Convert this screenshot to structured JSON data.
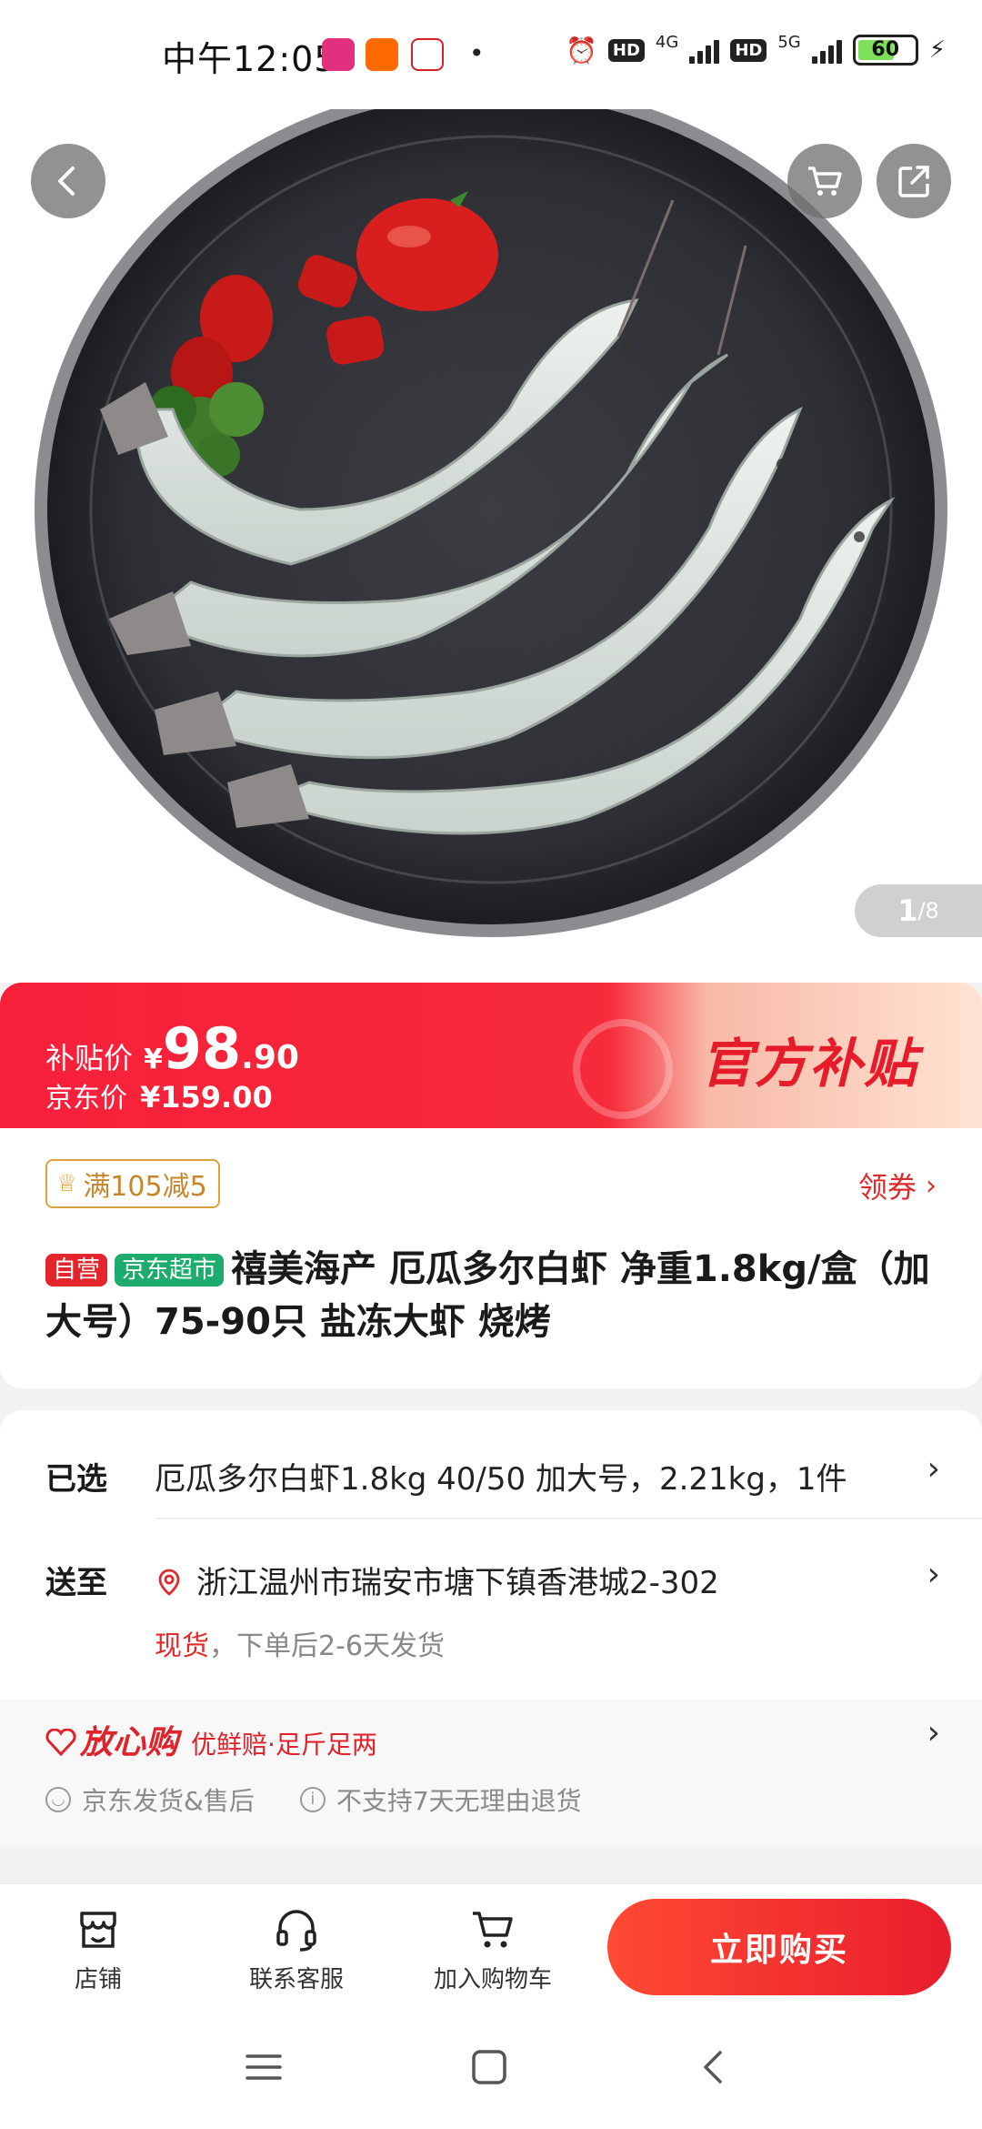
{
  "status_bar": {
    "time": "中午12:05",
    "app_icons": [
      "vipshop-icon",
      "taobao-icon",
      "kfc-icon"
    ],
    "network_1": "4G",
    "network_2": "5G",
    "battery": "60",
    "battery_level": 0.6
  },
  "hero": {
    "image_index": "1",
    "image_total": "/8"
  },
  "price": {
    "subsidy_label": "补贴价",
    "currency": "¥",
    "subsidy_int": "98",
    "subsidy_dec": ".90",
    "jd_label": "京东价",
    "jd_price": "¥159.00",
    "official_subsidy": "官方补贴"
  },
  "info": {
    "coupon": "满105减5",
    "get_coupon": "领券",
    "tag_self": "自营",
    "tag_supermarket": "京东超市",
    "title": "禧美海产 厄瓜多尔白虾 净重1.8kg/盒（加大号）75-90只  盐冻大虾 烧烤"
  },
  "selection": {
    "selected_label": "已选",
    "selected_value": "厄瓜多尔白虾1.8kg 40/50 加大号，2.21kg，1件",
    "ship_label": "送至",
    "address": "浙江温州市瑞安市塘下镇香港城2-302",
    "stock_status": "现货",
    "ship_note": "，下单后2-6天发货"
  },
  "assurance": {
    "brand": "放心购",
    "sub": "优鲜赔·足斤足两",
    "item_1": "京东发货&售后",
    "item_2": "不支持7天无理由退货"
  },
  "bottom_bar": {
    "store": "店铺",
    "service": "联系客服",
    "cart": "加入购物车",
    "buy": "立即购买"
  },
  "colors": {
    "accent_red": "#e4262c",
    "supermarket_green": "#1dab6e",
    "coupon_gold": "#d9a23a"
  }
}
